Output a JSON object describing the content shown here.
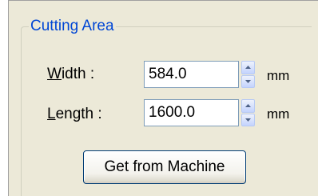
{
  "group": {
    "title": "Cutting Area"
  },
  "fields": [
    {
      "label_underlined": "W",
      "label_rest": "idth :",
      "value": "584.0",
      "unit": "mm"
    },
    {
      "label_underlined": "L",
      "label_rest": "ength :",
      "value": "1600.0",
      "unit": "mm"
    }
  ],
  "actions": {
    "get_from_machine_label": "Get from Machine"
  },
  "icons": {
    "spin_up": "spin-up-arrow-icon",
    "spin_down": "spin-down-arrow-icon"
  },
  "colors": {
    "group_title": "#0046d5",
    "panel_background": "#ece9d8",
    "input_border": "#7f9db9",
    "button_border": "#003c74"
  }
}
